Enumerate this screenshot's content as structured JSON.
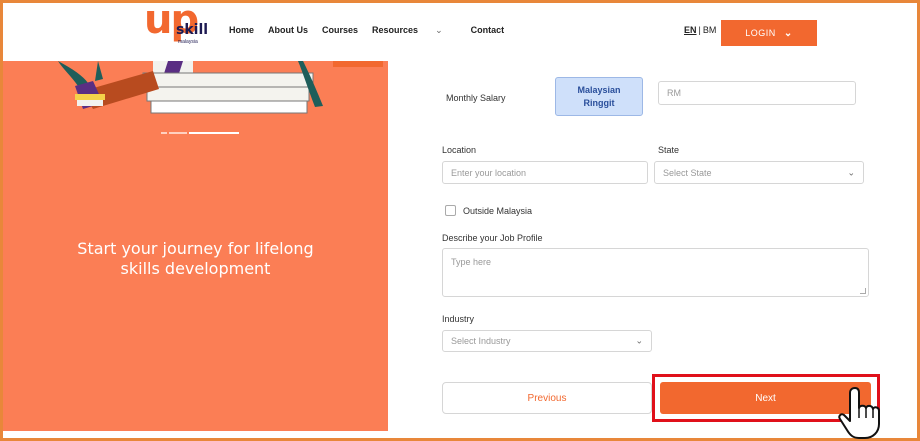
{
  "header": {
    "logo": {
      "mark": "up",
      "word": "skill",
      "sub": "malaysia"
    },
    "nav": [
      {
        "label": "Home"
      },
      {
        "label": "About Us"
      },
      {
        "label": "Courses"
      },
      {
        "label": "Resources",
        "icon": "chevron-down-icon"
      },
      {
        "label": "Contact"
      }
    ],
    "lang": {
      "active": "EN",
      "separator": "|",
      "other": "BM"
    },
    "login": {
      "label": "LOGIN",
      "icon": "chevron-down-icon"
    }
  },
  "left": {
    "tagline_line1": "Start your journey for lifelong",
    "tagline_line2": "skills development"
  },
  "form": {
    "salary": {
      "label": "Monthly Salary",
      "currency_line1": "Malaysian",
      "currency_line2": "Ringgit",
      "placeholder": "RM"
    },
    "location": {
      "label": "Location",
      "placeholder": "Enter your location"
    },
    "state": {
      "label": "State",
      "placeholder": "Select State"
    },
    "outside": {
      "label": "Outside Malaysia",
      "checked": false
    },
    "job_profile": {
      "label": "Describe your Job Profile",
      "placeholder": "Type here"
    },
    "industry": {
      "label": "Industry",
      "placeholder": "Select Industry"
    },
    "previous_label": "Previous",
    "next_label": "Next"
  },
  "colors": {
    "brand": "#f2682f",
    "panel": "#fb7e55",
    "highlight": "#e0101a",
    "currency_bg": "#cfe0fa"
  }
}
